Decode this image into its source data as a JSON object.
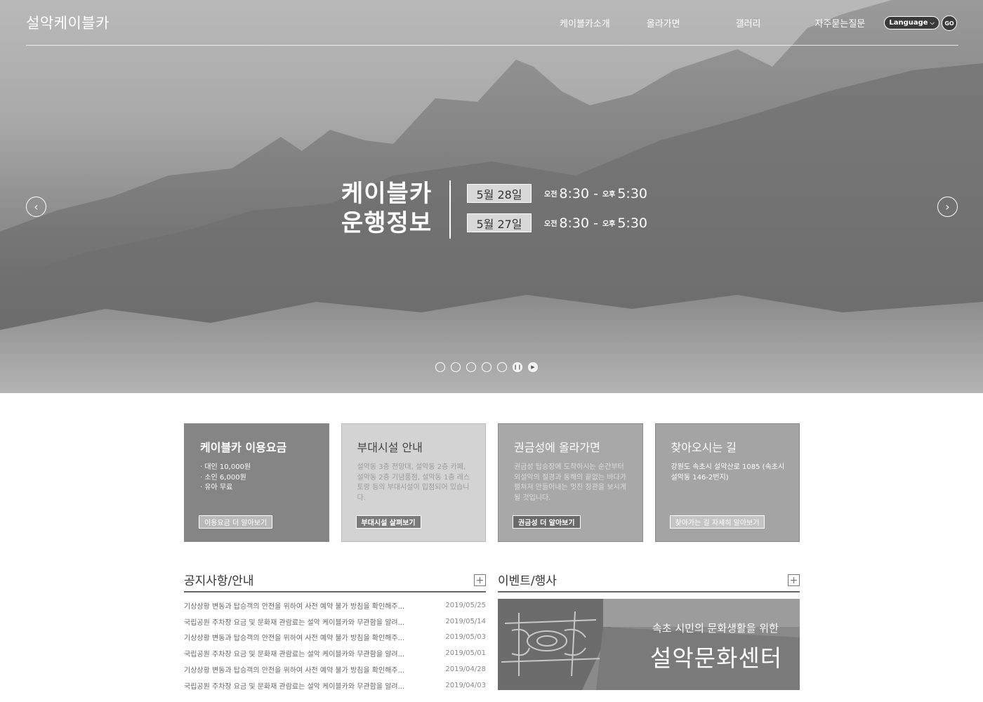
{
  "header": {
    "logo": "설악케이블카",
    "nav": [
      "케이블카소개",
      "올라가면",
      "갤러리",
      "자주묻는질문"
    ],
    "language_label": "Language",
    "go_label": "GO"
  },
  "hero": {
    "title_line1": "케이블카",
    "title_line2": "운행정보",
    "schedule": [
      {
        "date": "5월 28일",
        "am": "오전",
        "start": "8:30",
        "dash": "-",
        "pm": "오후",
        "end": "5:30"
      },
      {
        "date": "5월 27일",
        "am": "오전",
        "start": "8:30",
        "dash": "-",
        "pm": "오후",
        "end": "5:30"
      }
    ],
    "slider_dots": 5,
    "pause_icon": "pause-icon",
    "play_icon": "play-icon"
  },
  "cards": [
    {
      "title": "케이블카 이용요금",
      "lines": [
        "· 대인 10,000원",
        "· 소인 6,000원",
        "· 유아 무료"
      ],
      "button": "이용요금 더 알아보기"
    },
    {
      "title": "부대시설 안내",
      "body": "설악동 3층 전망대, 설악동 2층 카페, 설악동 2층 기념품점, 설악동 1층 레스토랑 등의 부대시설이 입점되어 있습니다.",
      "button": "부대시설 살펴보기"
    },
    {
      "title": "권금성에 올라가면",
      "body": "권금성 탑승장에 도착하시는 순간부터 외설악의 절경과 동해의 끝없는 바다가 펼쳐져 만들어내는 멋진 장관을 보시게 될 것입니다.",
      "button": "권금성 더 알아보기"
    },
    {
      "title": "찾아오시는 길",
      "body": "강원도 속초시 설악산로 1085 (속초시 설악동 146-2번지)",
      "button": "찾아가는 길 자세히 알아보기"
    }
  ],
  "notice": {
    "title": "공지사항/안내",
    "items": [
      {
        "text": "기상상황 변동과 탑승객의 안전을 위하여 사전 예약 불가 방침을 확인해주...",
        "date": "2019/05/25"
      },
      {
        "text": "국립공원 주차장 요금 및 문화재 관람료는 설악 케이블카와 무관함을 알려...",
        "date": "2019/05/14"
      },
      {
        "text": "기상상황 변동과 탑승객의 안전을 위하여 사전 예약 불가 방침을 확인해주...",
        "date": "2019/05/03"
      },
      {
        "text": "국립공원 주차장 요금 및 문화재 관람료는 설악 케이블카와 무관함을 알려...",
        "date": "2019/05/01"
      },
      {
        "text": "기상상황 변동과 탑승객의 안전을 위하여 사전 예약 불가 방침을 확인해주...",
        "date": "2019/04/28"
      },
      {
        "text": "국립공원 주차장 요금 및 문화재 관람료는 설악 케이블카와 무관함을 알려...",
        "date": "2019/04/03"
      }
    ]
  },
  "event": {
    "title": "이벤트/행사",
    "banner_sub": "속초 시민의 문화생활을 위한",
    "banner_main": "설악문화센터"
  }
}
